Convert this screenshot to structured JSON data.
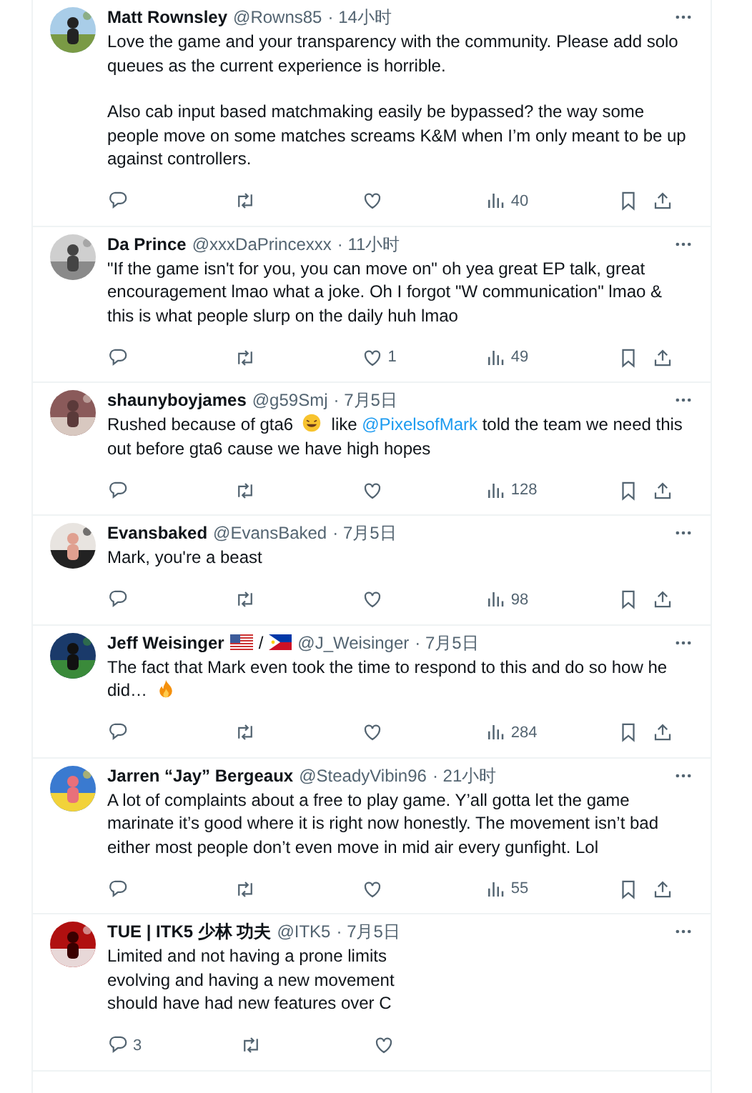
{
  "tweets": [
    {
      "name": "Matt Rownsley",
      "handle": "@Rowns85",
      "time": "· 14小时",
      "paragraphs": [
        [
          {
            "kind": "text",
            "text": "Love the game and your transparency with the community. Please add solo queues as the current experience is horrible."
          }
        ],
        [
          {
            "kind": "text",
            "text": "Also cab input based matchmaking easily be bypassed? the way some people move on some matches screams K&M when I’m only meant to be up against controllers."
          }
        ]
      ],
      "actions": [
        {
          "kind": "reply"
        },
        {
          "kind": "repost"
        },
        {
          "kind": "like"
        },
        {
          "kind": "views",
          "count": "40"
        },
        {
          "kind": "bookmark"
        },
        {
          "kind": "share"
        }
      ]
    },
    {
      "name": "Da Prince",
      "handle": "@xxxDaPrincexxx",
      "time": "· 11小时",
      "paragraphs": [
        [
          {
            "kind": "text",
            "text": "\"If the game isn't for you, you can move on\" oh yea great EP talk, great encouragement lmao what a joke. Oh I forgot \"W communication\" lmao & this is what people slurp on the daily huh lmao"
          }
        ]
      ],
      "actions": [
        {
          "kind": "reply"
        },
        {
          "kind": "repost"
        },
        {
          "kind": "like",
          "count": "1"
        },
        {
          "kind": "views",
          "count": "49"
        },
        {
          "kind": "bookmark"
        },
        {
          "kind": "share"
        }
      ]
    },
    {
      "name": "shaunyboyjames",
      "handle": "@g59Smj",
      "time": "· 7月5日",
      "paragraphs": [
        [
          {
            "kind": "text",
            "text": "Rushed because of gta6"
          },
          {
            "kind": "laugh"
          },
          {
            "kind": "text",
            "text": "like"
          },
          {
            "kind": "mention",
            "text": "@PixelsofMark"
          },
          {
            "kind": "text",
            "text": "told the team we need this out before gta6 cause we have high hopes"
          }
        ]
      ],
      "actions": [
        {
          "kind": "reply"
        },
        {
          "kind": "repost"
        },
        {
          "kind": "like"
        },
        {
          "kind": "views",
          "count": "128"
        },
        {
          "kind": "bookmark"
        },
        {
          "kind": "share"
        }
      ]
    },
    {
      "name": "Evansbaked",
      "handle": "@EvansBaked",
      "time": "· 7月5日",
      "paragraphs": [
        [
          {
            "kind": "text",
            "text": "Mark, you're a beast"
          }
        ]
      ],
      "actions": [
        {
          "kind": "reply"
        },
        {
          "kind": "repost"
        },
        {
          "kind": "like"
        },
        {
          "kind": "views",
          "count": "98"
        },
        {
          "kind": "bookmark"
        },
        {
          "kind": "share"
        }
      ]
    },
    {
      "name": "Jeff Weisinger",
      "flag_separator": "/",
      "handle": "@J_Weisinger",
      "time": "· 7月5日",
      "paragraphs": [
        [
          {
            "kind": "text",
            "text": "The fact that Mark even took the time to respond to this and do so how he did…"
          },
          {
            "kind": "fire"
          }
        ]
      ],
      "actions": [
        {
          "kind": "reply"
        },
        {
          "kind": "repost"
        },
        {
          "kind": "like"
        },
        {
          "kind": "views",
          "count": "284"
        },
        {
          "kind": "bookmark"
        },
        {
          "kind": "share"
        }
      ]
    },
    {
      "name": "Jarren “Jay” Bergeaux",
      "handle": "@SteadyVibin96",
      "time": "· 21小时",
      "paragraphs": [
        [
          {
            "kind": "text",
            "text": "A lot of complaints about a free to play game. Y’all gotta let the game marinate it’s good where it is right now honestly. The movement isn’t bad either most people don’t even move in mid air every gunfight. Lol"
          }
        ]
      ],
      "actions": [
        {
          "kind": "reply"
        },
        {
          "kind": "repost"
        },
        {
          "kind": "like"
        },
        {
          "kind": "views",
          "count": "55"
        },
        {
          "kind": "bookmark"
        },
        {
          "kind": "share"
        }
      ]
    },
    {
      "name": "TUE | ITK5 少林 功夫",
      "handle": "@ITK5",
      "time": "· 7月5日",
      "lines": [
        "Limited and not having a prone limits",
        "evolving and having a new movement",
        "should have had new features over C"
      ],
      "actions": [
        {
          "kind": "reply",
          "count": "3"
        },
        {
          "kind": "repost"
        },
        {
          "kind": "like"
        }
      ]
    }
  ]
}
